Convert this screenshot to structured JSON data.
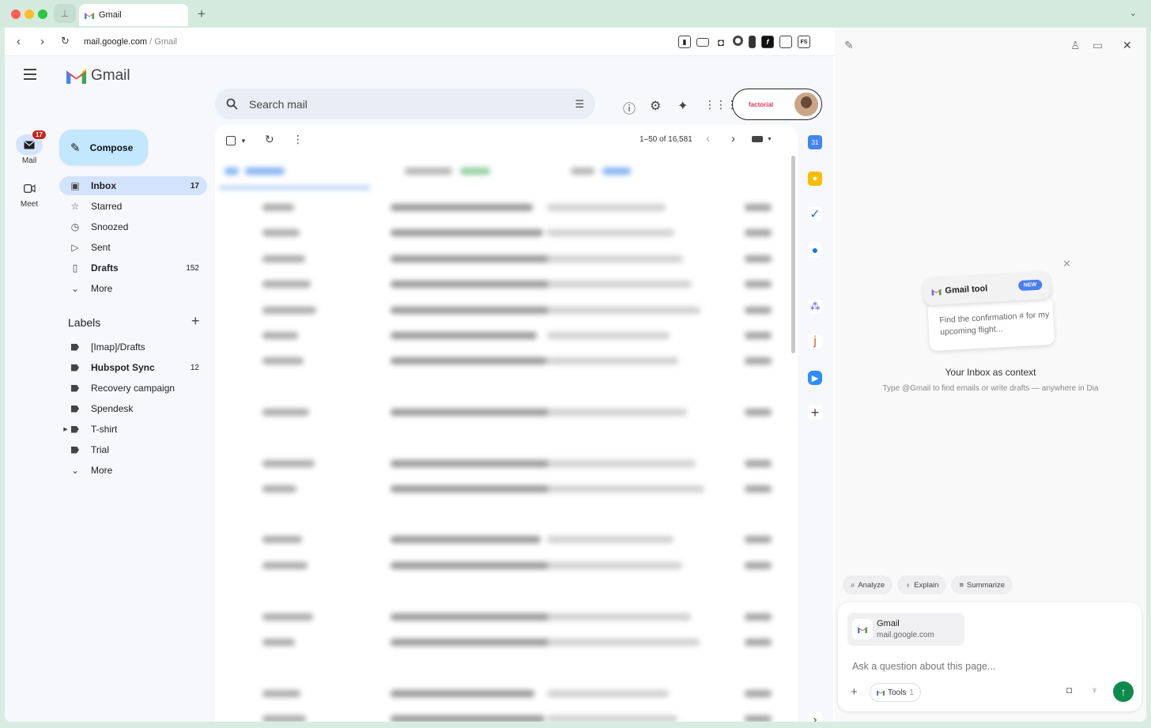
{
  "browser": {
    "tab_title": "Gmail",
    "url_host": "mail.google.com",
    "url_path": " / Gmail",
    "ext_icons": [
      "password-manager-icon",
      "screen-icon",
      "camera-icon",
      "puzzle-icon",
      "phone-icon",
      "font-icon",
      "crop-icon",
      "fs-icon"
    ]
  },
  "gmail": {
    "app_name": "Gmail",
    "rail": [
      {
        "label": "Mail",
        "badge": "17"
      },
      {
        "label": "Meet"
      }
    ],
    "compose_label": "Compose",
    "nav": [
      {
        "label": "Inbox",
        "count": "17",
        "icon": "inbox-icon",
        "active": true
      },
      {
        "label": "Starred",
        "count": "",
        "icon": "star-icon"
      },
      {
        "label": "Snoozed",
        "count": "",
        "icon": "clock-icon"
      },
      {
        "label": "Sent",
        "count": "",
        "icon": "send-icon"
      },
      {
        "label": "Drafts",
        "count": "152",
        "icon": "file-icon"
      },
      {
        "label": "More",
        "count": "",
        "icon": "chevron-down-icon"
      }
    ],
    "labels_title": "Labels",
    "labels": [
      {
        "label": "[Imap]/Drafts",
        "count": ""
      },
      {
        "label": "Hubspot Sync",
        "count": "12"
      },
      {
        "label": "Recovery campaign",
        "count": ""
      },
      {
        "label": "Spendesk",
        "count": ""
      },
      {
        "label": "T-shirt",
        "count": ""
      },
      {
        "label": "Trial",
        "count": ""
      },
      {
        "label": "More",
        "count": ""
      }
    ],
    "search_placeholder": "Search mail",
    "account_brand": "factorial",
    "pagination": "1–50 of 16,581"
  },
  "dia": {
    "tool_card_title": "Gmail tool",
    "tool_card_badge": "NEW",
    "tool_card_prompt": "Find the confirmation # for my upcoming flight...",
    "context_title": "Your Inbox as context",
    "context_subtitle": "Type @Gmail to find emails or write drafts — anywhere in Dia",
    "chips": [
      "Analyze",
      "Explain",
      "Summarize"
    ],
    "context_chip_title": "Gmail",
    "context_chip_url": "mail.google.com",
    "ask_placeholder": "Ask a question about this page...",
    "tools_label": "Tools",
    "tools_count": "1",
    "send_color": "#0f8a4e"
  }
}
